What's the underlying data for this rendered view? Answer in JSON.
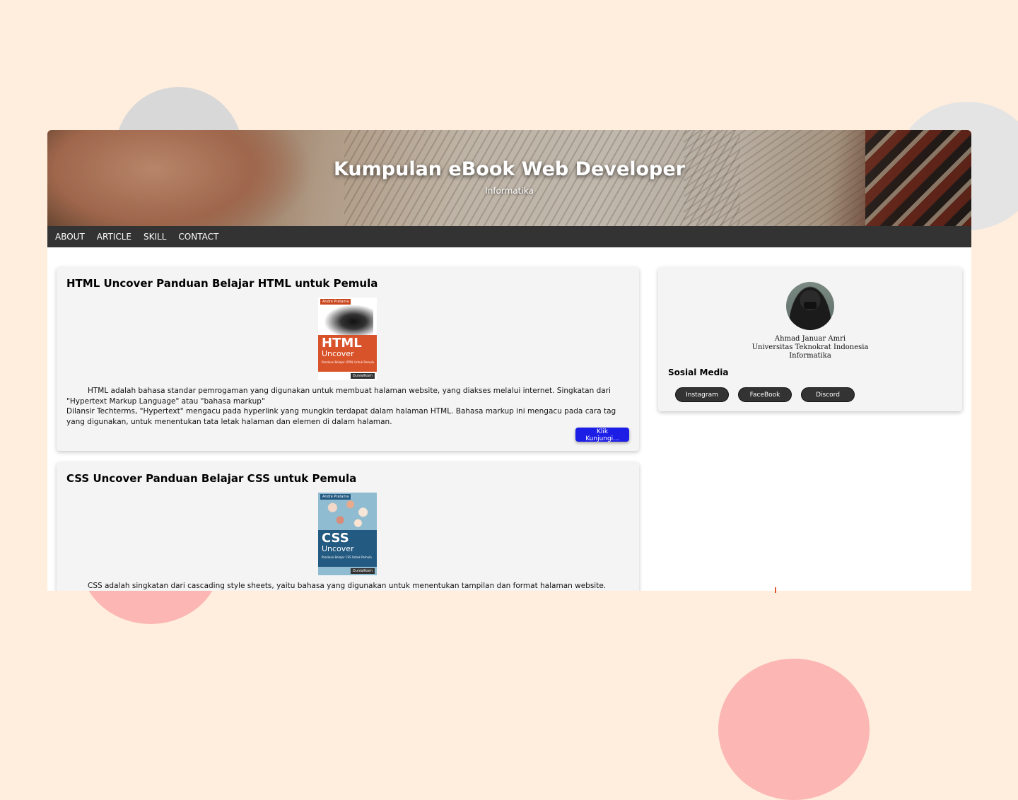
{
  "header": {
    "title": "Kumpulan eBook Web Developer",
    "subtitle": "Informatika"
  },
  "nav": {
    "items": [
      "ABOUT",
      "ARTICLE",
      "SKILL",
      "CONTACT"
    ]
  },
  "articles": [
    {
      "title": "HTML Uncover Panduan Belajar HTML untuk Pemula",
      "cover": {
        "author": "Andre Pratama",
        "big": "HTML",
        "small": "Uncover",
        "tagline": "Panduan Belajar HTML Untuk Pemula",
        "publisher": "DuniaIlkom",
        "color": "#d9532a"
      },
      "paragraph_1": "HTML adalah bahasa standar pemrogaman yang digunakan untuk membuat halaman website, yang diakses melalui internet. Singkatan dari \"Hypertext Markup Language\" atau \"bahasa markup\"",
      "paragraph_2": "Dilansir Techterms, \"Hypertext\" mengacu pada hyperlink yang mungkin terdapat dalam halaman HTML. Bahasa markup ini mengacu pada cara tag yang digunakan, untuk menentukan tata letak halaman dan elemen di dalam halaman.",
      "button": "Klik Kunjungi..."
    },
    {
      "title": "CSS Uncover Panduan Belajar CSS untuk Pemula",
      "cover": {
        "author": "Andre Pratama",
        "big": "CSS",
        "small": "Uncover",
        "tagline": "Panduan Belajar CSS Untuk Pemula",
        "publisher": "DuniaIlkom",
        "color": "#235a82"
      },
      "paragraph_1": "CSS adalah singkatan dari cascading style sheets, yaitu bahasa yang digunakan untuk menentukan tampilan dan format halaman website. Dengan CSS, Anda"
    }
  ],
  "profile": {
    "name": "Ahmad Januar Amri",
    "school": "Universitas Teknokrat Indonesia",
    "major": "Informatika",
    "social_heading": "Sosial Media",
    "social_buttons": [
      "Instagram",
      "FaceBook",
      "Discord"
    ]
  },
  "colors": {
    "background": "#ffeedd",
    "nav": "#333333",
    "accent_button": "#1c1de5",
    "card": "#f4f4f4"
  }
}
